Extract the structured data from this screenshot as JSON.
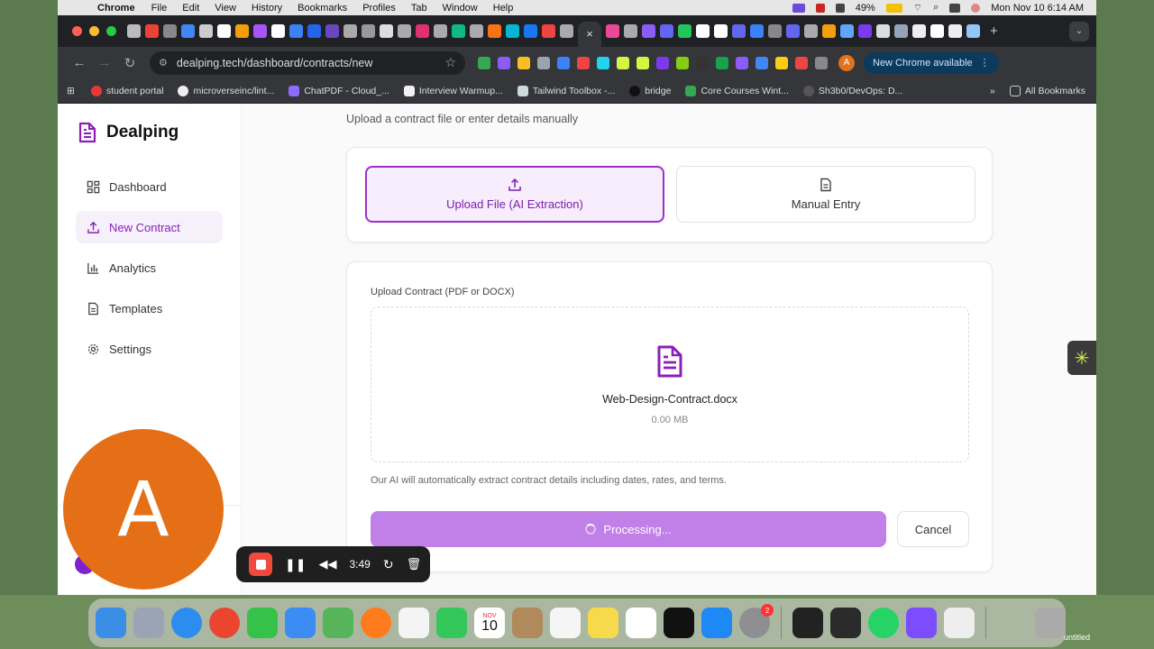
{
  "menubar": {
    "app": "Chrome",
    "items": [
      "File",
      "Edit",
      "View",
      "History",
      "Bookmarks",
      "Profiles",
      "Tab",
      "Window",
      "Help"
    ],
    "battery": "49%",
    "datetime": "Mon Nov 10  6:14 AM"
  },
  "browser": {
    "url": "dealping.tech/dashboard/contracts/new",
    "new_chrome_label": "New Chrome available",
    "profile_initial": "A",
    "bookmarks": [
      "student portal",
      "microverseinc/lint...",
      "ChatPDF - Cloud_...",
      "Interview Warmup...",
      "Tailwind Toolbox -...",
      "bridge",
      "Core Courses Wint...",
      "Sh3b0/DevOps: D..."
    ],
    "all_bookmarks_label": "All Bookmarks"
  },
  "sidebar": {
    "brand": "Dealping",
    "items": [
      {
        "label": "Dashboard",
        "icon": "grid-icon"
      },
      {
        "label": "New Contract",
        "icon": "upload-icon"
      },
      {
        "label": "Analytics",
        "icon": "bar-chart-icon"
      },
      {
        "label": "Templates",
        "icon": "document-icon"
      },
      {
        "label": "Settings",
        "icon": "gear-icon"
      }
    ]
  },
  "main": {
    "subtitle": "Upload a contract file or enter details manually",
    "mode_upload": "Upload File (AI Extraction)",
    "mode_manual": "Manual Entry",
    "upload_label": "Upload Contract (PDF or DOCX)",
    "file_name": "Web-Design-Contract.docx",
    "file_size": "0.00 MB",
    "hint": "Our AI will automatically extract contract details including dates, rates, and terms.",
    "processing_label": "Processing...",
    "cancel_label": "Cancel"
  },
  "overlay": {
    "camera_initial": "A",
    "recording_time": "3:49"
  },
  "dock": {
    "calendar_month": "NOV",
    "calendar_day": "10",
    "settings_badge": "2",
    "untitled": "untitled"
  },
  "colors": {
    "accent": "#8b1fb8",
    "accent_light": "#f7edfd",
    "button": "#c17fe8"
  }
}
